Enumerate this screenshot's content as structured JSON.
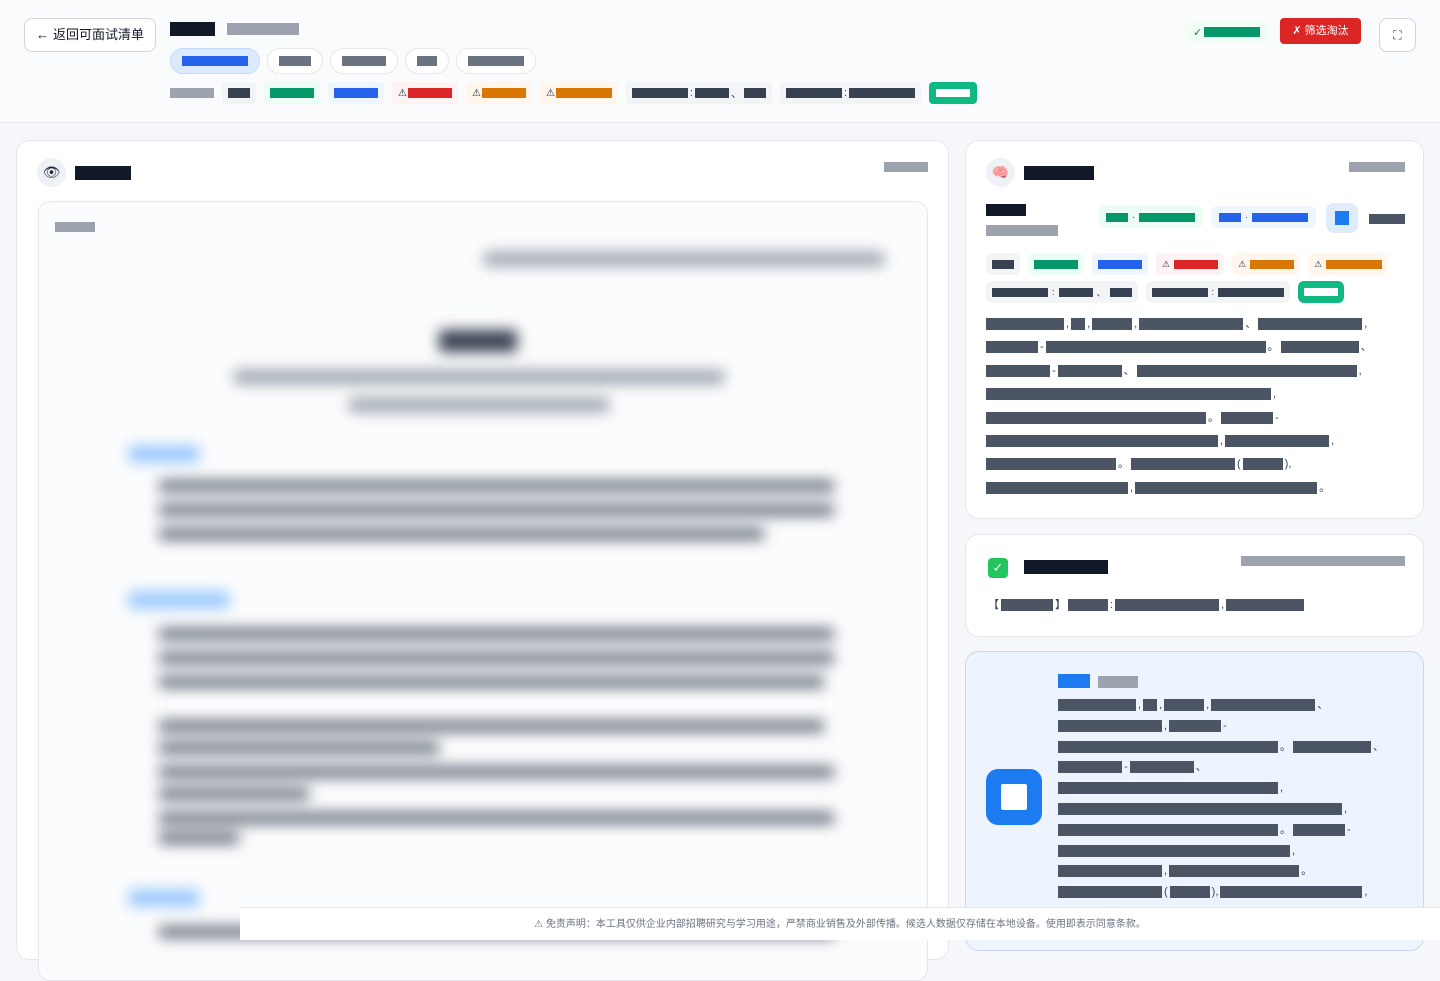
{
  "header": {
    "back_label": "返回可面试清单",
    "expand_icon": "expand-icon",
    "reject_label": "✗ 筛选淘汰",
    "pass_mark": "✓"
  },
  "left_panel": {
    "icon": "eye-icon"
  },
  "right_panel": {
    "analysis_icon": "brain-icon",
    "verdict_icon": "check-mark-icon",
    "logo_icon": "company-logo-icon"
  },
  "footer": {
    "disclaimer": "⚠ 免责声明：本工具仅供企业内部招聘研究与学习用途，严禁商业销售及外部传播。候选人数据仅存储在本地设备。使用即表示同意条款。"
  },
  "colors": {
    "primary": "#2563eb",
    "danger": "#dc2626",
    "success": "#10b981",
    "warning": "#d97706"
  }
}
